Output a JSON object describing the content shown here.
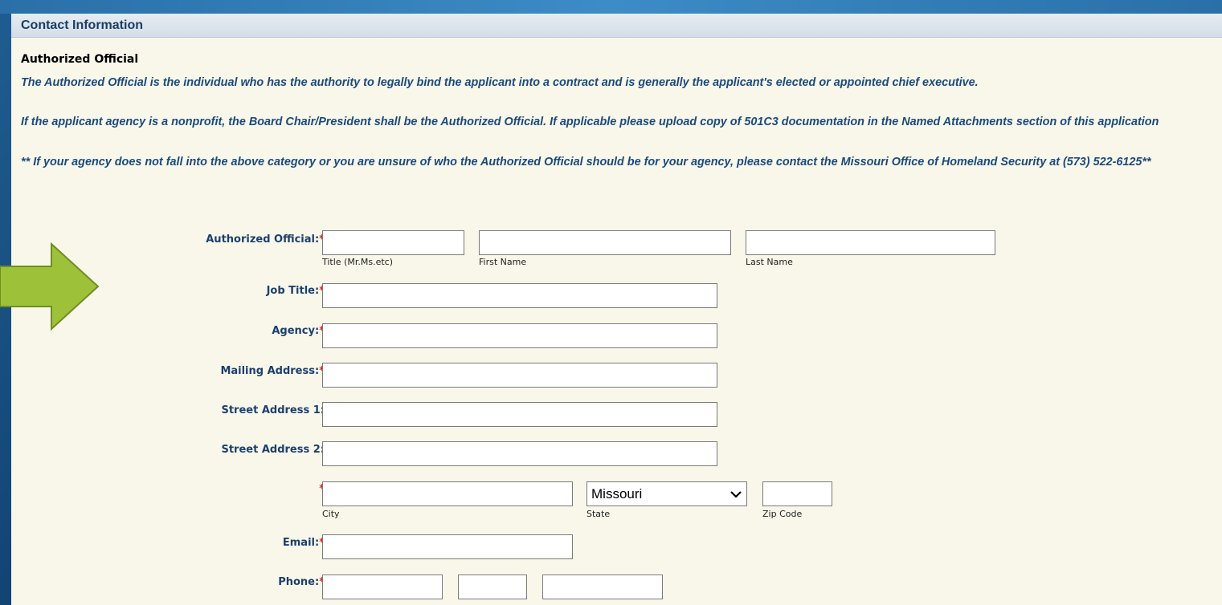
{
  "section": {
    "header": "Contact Information",
    "subheading": "Authorized Official",
    "note_1": "The Authorized Official is the individual who has the authority to legally bind the applicant into a contract and is generally the applicant's elected or appointed chief executive.",
    "note_2": "If the applicant agency is a nonprofit, the Board Chair/President shall be the Authorized Official. If applicable please upload copy of 501C3 documentation in the Named Attachments section of this application",
    "note_3": "** If your agency does not fall into the above category or you are unsure of who the Authorized Official should be for your agency, please contact the Missouri Office of Homeland Security at (573) 522-6125**"
  },
  "form": {
    "required_mark": "*",
    "authorized_official": {
      "label": "Authorized Official:",
      "title_caption": "Title (Mr.Ms.etc)",
      "first_caption": "First Name",
      "last_caption": "Last Name",
      "title_value": "",
      "first_value": "",
      "last_value": ""
    },
    "job_title": {
      "label": "Job Title:",
      "value": ""
    },
    "agency": {
      "label": "Agency:",
      "value": ""
    },
    "mailing_address": {
      "label": "Mailing Address:",
      "value": ""
    },
    "street_address_1": {
      "label": "Street Address 1:",
      "value": ""
    },
    "street_address_2": {
      "label": "Street Address 2:",
      "value": ""
    },
    "location": {
      "city_caption": "City",
      "state_caption": "State",
      "zip_caption": "Zip Code",
      "city_value": "",
      "state_value": "Missouri",
      "zip_value": ""
    },
    "email": {
      "label": "Email:",
      "value": ""
    },
    "phone": {
      "label": "Phone:",
      "office_value": "",
      "ext_value": "",
      "cell_value": ""
    }
  },
  "colors": {
    "panel_bg": "#f8f7ea",
    "label_blue": "#1c3f6e",
    "note_blue": "#1c4a7d",
    "required_red": "#d62020",
    "arrow_green": "#9dc23a"
  },
  "icons": {
    "pointer_arrow": "arrow-right-icon",
    "select_chevron": "chevron-down-icon"
  }
}
